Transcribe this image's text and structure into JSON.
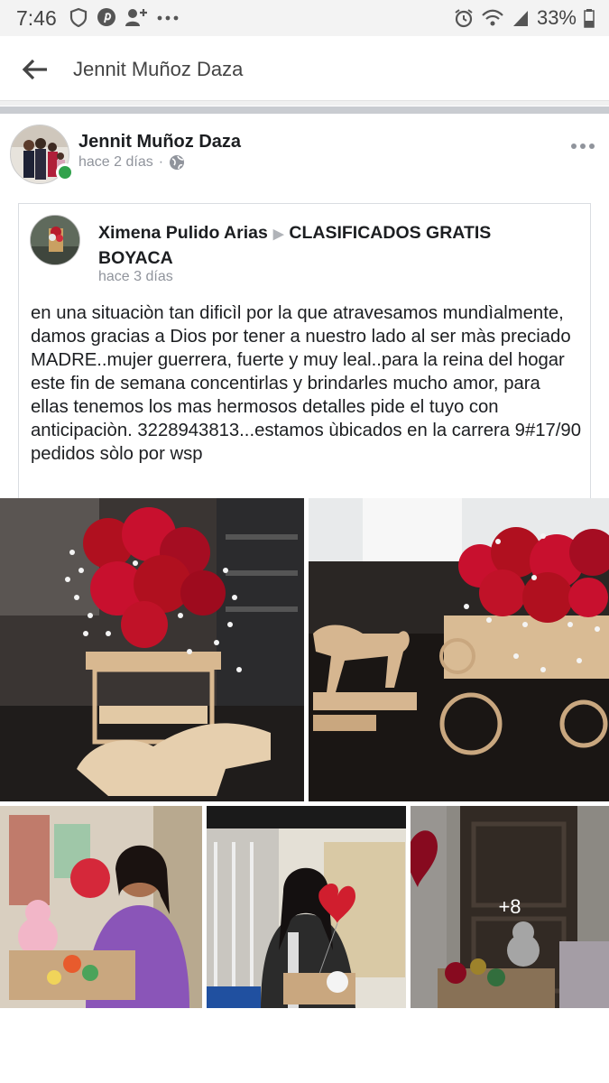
{
  "status_bar": {
    "time": "7:46",
    "battery": "33%",
    "left_icons": [
      "vpn-shield-icon",
      "pinterest-icon",
      "person-add-icon",
      "more-dots-icon"
    ],
    "right_icons": [
      "alarm-icon",
      "wifi-icon",
      "signal-icon",
      "battery-icon"
    ]
  },
  "header": {
    "title": "Jennit Muñoz Daza",
    "back_icon": "arrow-left-icon"
  },
  "post": {
    "author": "Jennit Muñoz Daza",
    "time": "hace 2 días",
    "separator": "·",
    "privacy_icon": "globe-icon",
    "online": true,
    "shared": {
      "author": "Ximena Pulido Arias",
      "arrow": "▶",
      "group": "CLASIFICADOS GRATIS BOYACA",
      "time": "hace 3 días",
      "text": "en una situaciòn tan dificìl por la que atravesamos mundìalmente, damos gracias a Dios por tener a nuestro lado al ser màs preciado MADRE..mujer guerrera, fuerte y muy leal..para la reina del hogar este fin de semana concentirlas y brindarles mucho amor, para ellas tenemos los mas hermosos detalles pide el tuyo con anticipaciòn. 3228943813...estamos ùbicados en la carrera 9#17/90 pedidos sòlo por wsp"
    },
    "photos": {
      "more_count": "+8"
    }
  },
  "colors": {
    "online_green": "#31a24c",
    "meta_grey": "#90949c",
    "text": "#1c1e21",
    "rose_red": "#c8102e"
  }
}
